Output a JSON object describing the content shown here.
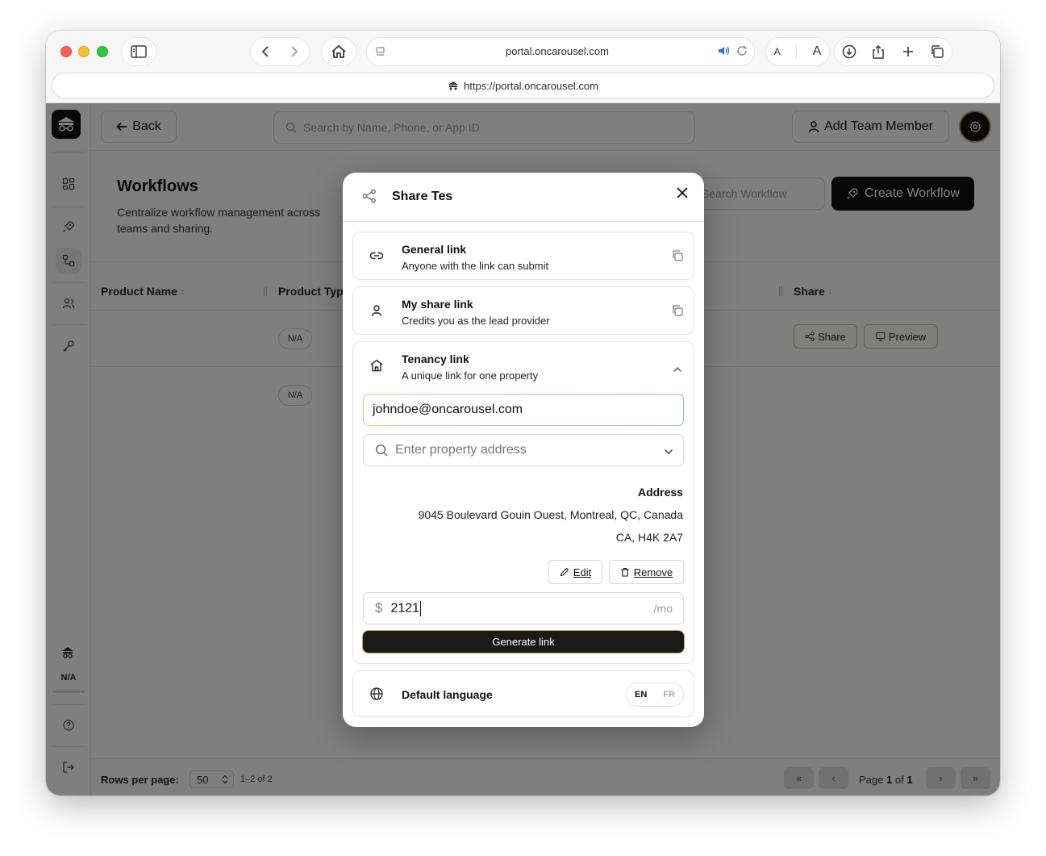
{
  "browser": {
    "tab_host": "portal.oncarousel.com",
    "address_url": "https://portal.oncarousel.com",
    "reader_small": "A",
    "reader_large": "A"
  },
  "sidebar": {
    "user_initials": "N/A"
  },
  "topbar": {
    "back_label": "Back",
    "search_placeholder": "Search by Name, Phone, or App ID",
    "add_member_label": "Add Team Member"
  },
  "workflows": {
    "title": "Workflows",
    "description": "Centralize workflow management across teams and sharing.",
    "search_placeholder": "Search Workflow",
    "create_label": "Create Workflow"
  },
  "table": {
    "columns": [
      "Product Name",
      "Product Type",
      "Share"
    ],
    "rows": [
      {
        "type": "N/A",
        "share_label": "Share",
        "preview_label": "Preview"
      },
      {
        "type": "N/A"
      }
    ]
  },
  "footer": {
    "rows_label": "Rows per page:",
    "rows_value": "50",
    "range": "1–2 of 2",
    "page_prefix": "Page",
    "page_current": "1",
    "page_of": "of",
    "page_total": "1"
  },
  "modal": {
    "title": "Share Tes",
    "general": {
      "title": "General link",
      "subtitle": "Anyone with the link can submit"
    },
    "my_share": {
      "title": "My share link",
      "subtitle": "Credits you as the lead provider"
    },
    "tenancy": {
      "title": "Tenancy link",
      "subtitle": "A unique link for one property",
      "email_value": "johndoe@oncarousel.com",
      "address_placeholder": "Enter property address",
      "address_label": "Address",
      "address_line1": "9045 Boulevard Gouin Ouest, Montreal, QC, Canada",
      "address_line2": "CA, H4K 2A7",
      "edit_label": "Edit",
      "remove_label": "Remove",
      "rent_symbol": "$",
      "rent_value": "2121",
      "rent_unit": "/mo",
      "generate_label": "Generate link"
    },
    "language": {
      "title": "Default language",
      "options": [
        "EN",
        "FR"
      ],
      "selected": "EN"
    }
  },
  "colors": {
    "accent_gold": "#c9a14a",
    "primary_dark": "#111111",
    "overlay": "rgba(0,0,0,0.5)"
  }
}
